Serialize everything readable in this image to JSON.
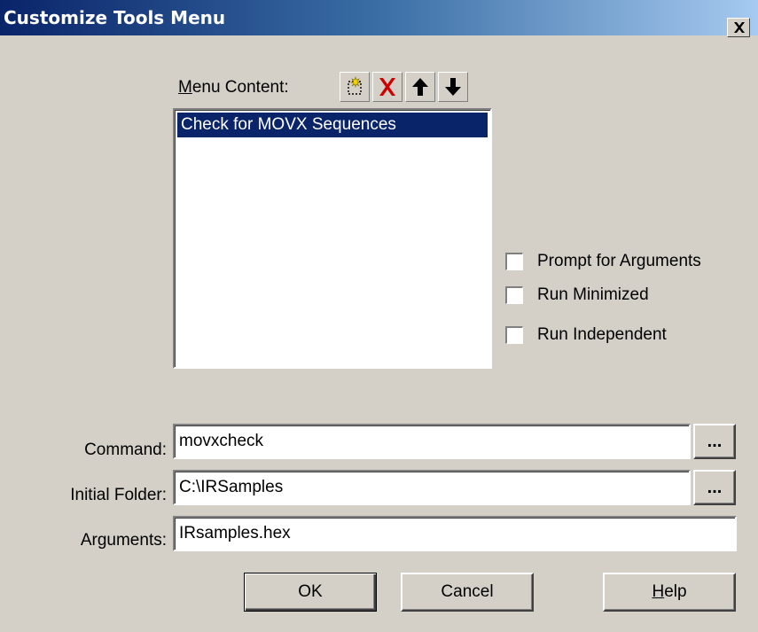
{
  "window": {
    "title": "Customize Tools Menu"
  },
  "menu_content": {
    "label_prefix": "",
    "label_accel": "M",
    "label_rest": "enu Content:",
    "toolbar": [
      {
        "icon": "new-item-icon"
      },
      {
        "icon": "delete-icon",
        "color": "#cc0000"
      },
      {
        "icon": "arrow-up-icon"
      },
      {
        "icon": "arrow-down-icon"
      }
    ],
    "items": [
      {
        "label": "Check for MOVX Sequences",
        "selected": true
      }
    ]
  },
  "options": {
    "prompt_for_arguments": {
      "label": "Prompt for  Arguments",
      "checked": false
    },
    "run_minimized": {
      "label": "Run Minimized",
      "checked": false
    },
    "run_independent": {
      "label": "Run Independent",
      "checked": false
    }
  },
  "fields": {
    "command": {
      "label": "Command:",
      "value": "movxcheck",
      "browse_label": "..."
    },
    "initial_folder": {
      "label": "Initial Folder:",
      "value": "C:\\IRSamples",
      "browse_label": "..."
    },
    "arguments": {
      "label": "Arguments:",
      "value": "IRsamples.hex"
    }
  },
  "buttons": {
    "ok": "OK",
    "cancel": "Cancel",
    "help_accel": "H",
    "help_rest": "elp"
  },
  "colors": {
    "face": "#d4d0c8",
    "title_start": "#0a246a",
    "title_end": "#a6caf0",
    "selection": "#0a246a"
  }
}
